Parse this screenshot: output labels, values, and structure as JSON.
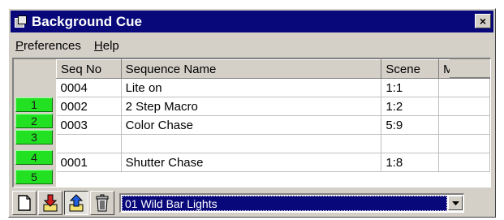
{
  "window": {
    "title": "Background Cue",
    "close_glyph": "×"
  },
  "menu": [
    {
      "accel": "P",
      "rest": "references"
    },
    {
      "accel": "H",
      "rest": "elp"
    }
  ],
  "grid": {
    "columns": [
      "Seq No",
      "Sequence Name",
      "Scene",
      "Mode"
    ],
    "rows": [
      {
        "indicator": "1",
        "seq_no": "0004",
        "name": "Lite on",
        "scene": "1:1",
        "mode": ""
      },
      {
        "indicator": "2",
        "seq_no": "0002",
        "name": "2 Step Macro",
        "scene": "1:2",
        "mode": ""
      },
      {
        "indicator": "3",
        "seq_no": "0003",
        "name": "Color Chase",
        "scene": "5:9",
        "mode": ""
      },
      {
        "indicator": "4",
        "seq_no": "",
        "name": "",
        "scene": "",
        "mode": ""
      },
      {
        "indicator": "5",
        "seq_no": "0001",
        "name": "Shutter Chase",
        "scene": "1:8",
        "mode": ""
      }
    ],
    "indicator_color": "#22e022"
  },
  "toolbar": {
    "buttons": [
      {
        "icon": "new-document-icon"
      },
      {
        "icon": "load-down-arrow-icon"
      },
      {
        "icon": "save-up-arrow-icon"
      },
      {
        "icon": "trash-icon"
      }
    ],
    "combo_value": "01 Wild Bar Lights"
  },
  "colors": {
    "titlebar": "#08087a",
    "face": "#d4d0c8",
    "selection": "#08087a"
  }
}
